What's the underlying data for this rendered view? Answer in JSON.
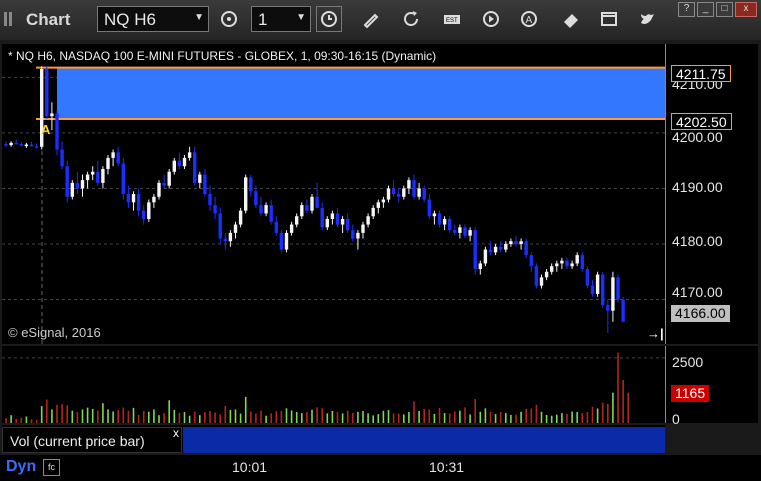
{
  "app": {
    "title": "Chart"
  },
  "toolbar": {
    "symbol": "NQ H6",
    "interval": "1",
    "icons": [
      "cycle-icon",
      "clock-icon",
      "pencil-icon",
      "refresh-icon",
      "easy-button-icon",
      "play-icon",
      "alert-icon",
      "eraser-icon",
      "window-icon",
      "twitter-icon"
    ]
  },
  "window_buttons": {
    "help": "?",
    "minimize": "_",
    "maximize": "□",
    "close": "x"
  },
  "chart": {
    "header": "* NQ H6, NASDAQ 100 E-MINI FUTURES - GLOBEX, 1, 09:30-16:15 (Dynamic)",
    "copyright": "© eSignal, 2016",
    "marker": "A",
    "end_arrow": "→|",
    "colors": {
      "up": "#f5f5f5",
      "down": "#1b2dff",
      "zone": "#3377ff",
      "zone_border": "#ff9a2e",
      "vol_up": "#7fd85a",
      "vol_down": "#b3261e"
    }
  },
  "price_scale": {
    "ticks": [
      "4210.00",
      "4200.00",
      "4190.00",
      "4180.00",
      "4170.00"
    ],
    "tags": {
      "zone_high": "4211.75",
      "zone_low": "4202.50",
      "last": "4166.00"
    }
  },
  "volume_scale": {
    "ticks": [
      "2500",
      "0"
    ],
    "current": "1165"
  },
  "volume_legend": {
    "label": "Vol (current price bar)",
    "close": "x"
  },
  "status": {
    "mode": "Dyn",
    "icon": "fc"
  },
  "time_axis": {
    "labels": [
      "10:01",
      "10:31"
    ]
  },
  "chart_data": {
    "type": "candlestick",
    "x_labels": [
      "10:01",
      "10:31"
    ],
    "ylim": [
      4162,
      4216
    ],
    "zone": [
      4202.5,
      4211.75
    ],
    "bars": [
      [
        4198.0,
        4198.5,
        4197.4,
        4197.8
      ],
      [
        4197.8,
        4198.5,
        4197.5,
        4198.2
      ],
      [
        4198.2,
        4198.8,
        4197.9,
        4198.0
      ],
      [
        4198.0,
        4198.3,
        4197.6,
        4197.7
      ],
      [
        4197.7,
        4198.2,
        4197.3,
        4197.9
      ],
      [
        4197.9,
        4198.4,
        4197.5,
        4197.6
      ],
      [
        4197.6,
        4198.1,
        4197.2,
        4197.5
      ],
      [
        4197.5,
        4212.0,
        4197.0,
        4211.5
      ],
      [
        4211.5,
        4212.0,
        4202.5,
        4203.0
      ],
      [
        4203.0,
        4205.5,
        4200.5,
        4203.5
      ],
      [
        4203.5,
        4204.0,
        4196.0,
        4197.0
      ],
      [
        4197.0,
        4198.5,
        4193.5,
        4194.0
      ],
      [
        4194.0,
        4195.0,
        4187.5,
        4188.5
      ],
      [
        4188.5,
        4191.5,
        4188.0,
        4191.0
      ],
      [
        4191.0,
        4193.0,
        4189.0,
        4190.0
      ],
      [
        4190.0,
        4192.5,
        4188.5,
        4191.5
      ],
      [
        4191.5,
        4193.0,
        4190.0,
        4192.5
      ],
      [
        4192.5,
        4194.0,
        4191.5,
        4193.0
      ],
      [
        4193.0,
        4195.0,
        4190.5,
        4191.0
      ],
      [
        4191.0,
        4194.0,
        4190.0,
        4193.5
      ],
      [
        4193.5,
        4196.0,
        4192.5,
        4195.5
      ],
      [
        4195.5,
        4197.0,
        4194.0,
        4196.5
      ],
      [
        4196.5,
        4197.5,
        4194.0,
        4194.5
      ],
      [
        4194.5,
        4195.5,
        4188.0,
        4189.0
      ],
      [
        4189.0,
        4190.5,
        4186.5,
        4187.5
      ],
      [
        4187.5,
        4189.5,
        4186.0,
        4189.0
      ],
      [
        4189.0,
        4190.0,
        4185.0,
        4186.0
      ],
      [
        4186.0,
        4187.0,
        4183.5,
        4184.5
      ],
      [
        4184.5,
        4188.0,
        4184.0,
        4187.5
      ],
      [
        4187.5,
        4189.0,
        4186.5,
        4188.5
      ],
      [
        4188.5,
        4191.5,
        4188.0,
        4191.0
      ],
      [
        4191.0,
        4192.5,
        4190.0,
        4190.5
      ],
      [
        4190.5,
        4193.5,
        4190.0,
        4193.0
      ],
      [
        4193.0,
        4195.5,
        4192.5,
        4195.0
      ],
      [
        4195.0,
        4196.5,
        4193.5,
        4194.0
      ],
      [
        4194.0,
        4196.0,
        4193.5,
        4195.5
      ],
      [
        4195.5,
        4197.5,
        4195.0,
        4196.5
      ],
      [
        4196.5,
        4197.5,
        4190.5,
        4191.0
      ],
      [
        4191.0,
        4193.0,
        4190.0,
        4192.5
      ],
      [
        4192.5,
        4193.5,
        4188.5,
        4189.0
      ],
      [
        4189.0,
        4190.5,
        4186.0,
        4187.0
      ],
      [
        4187.0,
        4188.5,
        4184.5,
        4185.5
      ],
      [
        4185.5,
        4186.5,
        4180.0,
        4181.0
      ],
      [
        4181.0,
        4182.0,
        4179.0,
        4180.5
      ],
      [
        4180.5,
        4182.5,
        4179.5,
        4182.0
      ],
      [
        4182.0,
        4184.0,
        4181.0,
        4183.5
      ],
      [
        4183.5,
        4186.5,
        4183.0,
        4186.0
      ],
      [
        4186.0,
        4192.5,
        4185.5,
        4192.0
      ],
      [
        4192.0,
        4192.5,
        4188.5,
        4189.5
      ],
      [
        4189.5,
        4190.5,
        4186.5,
        4187.0
      ],
      [
        4187.0,
        4188.5,
        4185.0,
        4185.5
      ],
      [
        4185.5,
        4187.5,
        4185.0,
        4187.0
      ],
      [
        4187.0,
        4188.0,
        4183.5,
        4184.0
      ],
      [
        4184.0,
        4185.0,
        4181.5,
        4182.0
      ],
      [
        4182.0,
        4182.5,
        4178.5,
        4179.0
      ],
      [
        4179.0,
        4182.5,
        4178.5,
        4182.0
      ],
      [
        4182.0,
        4184.0,
        4181.5,
        4183.5
      ],
      [
        4183.5,
        4185.5,
        4183.0,
        4185.0
      ],
      [
        4185.0,
        4187.5,
        4184.5,
        4187.0
      ],
      [
        4187.0,
        4188.0,
        4185.5,
        4186.0
      ],
      [
        4186.0,
        4189.0,
        4185.5,
        4188.5
      ],
      [
        4188.5,
        4191.0,
        4187.5,
        4186.5
      ],
      [
        4186.5,
        4187.5,
        4182.5,
        4183.0
      ],
      [
        4183.0,
        4185.0,
        4182.5,
        4184.5
      ],
      [
        4184.5,
        4186.0,
        4183.5,
        4185.5
      ],
      [
        4185.5,
        4186.5,
        4183.0,
        4183.5
      ],
      [
        4183.5,
        4185.0,
        4182.0,
        4184.5
      ],
      [
        4184.5,
        4185.5,
        4182.0,
        4182.5
      ],
      [
        4182.5,
        4183.5,
        4180.5,
        4181.0
      ],
      [
        4181.0,
        4182.5,
        4179.0,
        4182.0
      ],
      [
        4182.0,
        4184.0,
        4181.0,
        4183.5
      ],
      [
        4183.5,
        4185.5,
        4183.0,
        4185.0
      ],
      [
        4185.0,
        4187.0,
        4184.5,
        4186.5
      ],
      [
        4186.5,
        4188.0,
        4185.5,
        4187.5
      ],
      [
        4187.5,
        4188.5,
        4186.5,
        4188.0
      ],
      [
        4188.0,
        4190.5,
        4187.5,
        4190.0
      ],
      [
        4190.0,
        4191.5,
        4188.5,
        4189.0
      ],
      [
        4189.0,
        4190.0,
        4187.5,
        4188.5
      ],
      [
        4188.5,
        4190.5,
        4188.0,
        4190.0
      ],
      [
        4190.0,
        4192.0,
        4189.0,
        4191.5
      ],
      [
        4191.5,
        4192.5,
        4188.0,
        4188.5
      ],
      [
        4188.5,
        4191.0,
        4188.0,
        4190.0
      ],
      [
        4190.0,
        4190.5,
        4187.5,
        4188.0
      ],
      [
        4188.0,
        4189.0,
        4184.5,
        4185.0
      ],
      [
        4185.0,
        4186.0,
        4183.5,
        4185.5
      ],
      [
        4185.5,
        4186.0,
        4183.0,
        4183.5
      ],
      [
        4183.5,
        4185.0,
        4182.5,
        4184.5
      ],
      [
        4184.5,
        4185.0,
        4182.0,
        4182.5
      ],
      [
        4182.5,
        4183.5,
        4181.5,
        4182.0
      ],
      [
        4182.0,
        4183.5,
        4181.0,
        4183.0
      ],
      [
        4183.0,
        4183.5,
        4181.0,
        4181.5
      ],
      [
        4181.5,
        4183.0,
        4180.5,
        4182.5
      ],
      [
        4182.5,
        4183.0,
        4174.5,
        4175.5
      ],
      [
        4175.5,
        4177.0,
        4174.5,
        4176.5
      ],
      [
        4176.5,
        4179.5,
        4176.0,
        4179.0
      ],
      [
        4179.0,
        4180.5,
        4178.0,
        4178.5
      ],
      [
        4178.5,
        4180.0,
        4178.0,
        4179.5
      ],
      [
        4179.5,
        4180.5,
        4178.5,
        4179.0
      ],
      [
        4179.0,
        4180.5,
        4178.5,
        4180.0
      ],
      [
        4180.0,
        4181.0,
        4179.5,
        4180.5
      ],
      [
        4180.5,
        4181.5,
        4179.5,
        4180.0
      ],
      [
        4180.0,
        4181.0,
        4179.0,
        4180.5
      ],
      [
        4180.5,
        4181.0,
        4177.5,
        4178.0
      ],
      [
        4178.0,
        4178.5,
        4175.0,
        4176.0
      ],
      [
        4176.0,
        4176.5,
        4172.0,
        4172.5
      ],
      [
        4172.5,
        4174.5,
        4172.0,
        4174.0
      ],
      [
        4174.0,
        4175.5,
        4173.5,
        4175.0
      ],
      [
        4175.0,
        4176.5,
        4174.5,
        4176.0
      ],
      [
        4176.0,
        4177.0,
        4175.0,
        4176.5
      ],
      [
        4176.5,
        4177.5,
        4175.5,
        4177.0
      ],
      [
        4177.0,
        4177.5,
        4175.5,
        4176.0
      ],
      [
        4176.0,
        4177.0,
        4175.5,
        4176.5
      ],
      [
        4176.5,
        4178.5,
        4176.0,
        4178.0
      ],
      [
        4178.0,
        4178.5,
        4175.0,
        4175.5
      ],
      [
        4175.5,
        4176.0,
        4172.0,
        4172.5
      ],
      [
        4172.5,
        4173.5,
        4170.5,
        4171.0
      ],
      [
        4171.0,
        4175.0,
        4170.5,
        4174.5
      ],
      [
        4174.5,
        4175.0,
        4168.5,
        4169.0
      ],
      [
        4169.0,
        4170.0,
        4164.0,
        4168.0
      ],
      [
        4168.0,
        4175.0,
        4166.0,
        4174.0
      ],
      [
        4174.0,
        4174.5,
        4169.5,
        4170.0
      ],
      [
        4170.0,
        4170.5,
        4166.0,
        4166.0
      ]
    ],
    "volume": [
      180,
      300,
      160,
      200,
      250,
      140,
      120,
      650,
      900,
      520,
      700,
      720,
      680,
      470,
      420,
      520,
      590,
      540,
      480,
      760,
      520,
      440,
      500,
      590,
      470,
      580,
      310,
      460,
      430,
      520,
      300,
      380,
      870,
      500,
      390,
      420,
      280,
      440,
      300,
      420,
      460,
      400,
      330,
      650,
      500,
      520,
      360,
      1000,
      440,
      360,
      480,
      280,
      370,
      450,
      460,
      560,
      480,
      420,
      380,
      420,
      510,
      600,
      560,
      370,
      460,
      430,
      370,
      470,
      390,
      430,
      460,
      370,
      290,
      340,
      470,
      500,
      370,
      360,
      330,
      420,
      830,
      460,
      540,
      520,
      350,
      580,
      380,
      360,
      440,
      470,
      600,
      330,
      920,
      430,
      560,
      430,
      340,
      420,
      380,
      310,
      320,
      430,
      540,
      560,
      700,
      430,
      310,
      280,
      320,
      380,
      350,
      440,
      420,
      380,
      420,
      620,
      560,
      780,
      730,
      1165,
      2700,
      1650,
      1165
    ],
    "volume_ylim": [
      0,
      2800
    ]
  }
}
